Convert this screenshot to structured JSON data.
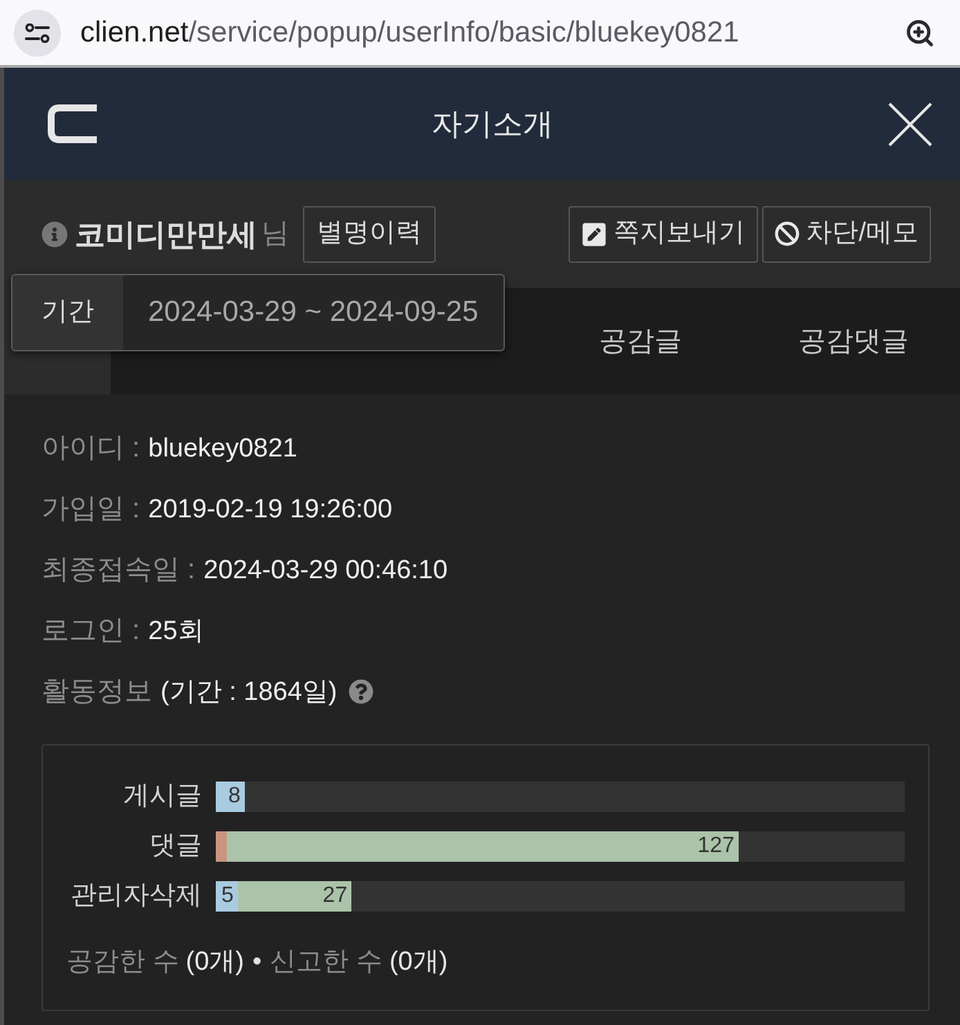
{
  "address_bar": {
    "host": "clien.net",
    "path": "/service/popup/userInfo/basic/bluekey0821"
  },
  "header": {
    "title": "자기소개"
  },
  "profile": {
    "nickname": "코미디만만세",
    "honorific": "님",
    "nickname_button": {
      "label": "별명이력"
    },
    "actions": [
      {
        "kind": "message",
        "label": "쪽지보내기"
      },
      {
        "kind": "block",
        "label": "차단/메모"
      }
    ]
  },
  "tooltip": {
    "label": "기간",
    "value": "2024-03-29 ~ 2024-09-25"
  },
  "tabs": [
    {
      "label": "공감글",
      "selected": false
    },
    {
      "label": "공감댓글",
      "selected": false
    }
  ],
  "info_rows": [
    {
      "label": "아이디 :",
      "value": "bluekey0821"
    },
    {
      "label": "가입일 :",
      "value": "2019-02-19 19:26:00"
    },
    {
      "label": "최종접속일 :",
      "value": "2024-03-29 00:46:10"
    },
    {
      "label": "로그인 :",
      "value": "25회"
    }
  ],
  "activity": {
    "label": "활동정보",
    "period": "(기간 : 1864일)"
  },
  "stats": {
    "bars": [
      {
        "label": "게시글",
        "segments": [
          {
            "color": "#a8cbe0",
            "level": 0.042,
            "value": "8"
          }
        ]
      },
      {
        "label": "댓글",
        "segments": [
          {
            "color": "#c99480",
            "level": 0.016
          },
          {
            "color": "#abc3a9",
            "level": 0.759,
            "value": "127"
          }
        ]
      },
      {
        "label": "관리자삭제",
        "segments": [
          {
            "color": "#a8cbe0",
            "level": 0.032,
            "value": "5"
          },
          {
            "color": "#abc3a9",
            "level": 0.197,
            "value": "27"
          }
        ]
      }
    ],
    "footer": [
      {
        "label": "공감한 수",
        "value": "(0개)"
      },
      {
        "label": "신고한 수",
        "value": "(0개)"
      }
    ],
    "separator": "•"
  }
}
